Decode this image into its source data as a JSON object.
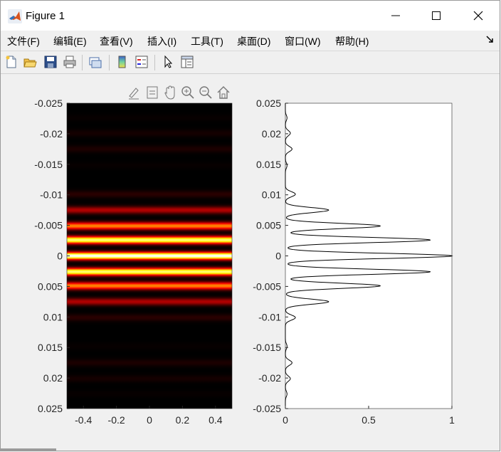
{
  "window": {
    "title": "Figure 1",
    "controls": [
      "minimize",
      "maximize",
      "close"
    ]
  },
  "menu": [
    {
      "label": "文件(F)"
    },
    {
      "label": "编辑(E)"
    },
    {
      "label": "查看(V)"
    },
    {
      "label": "插入(I)"
    },
    {
      "label": "工具(T)"
    },
    {
      "label": "桌面(D)"
    },
    {
      "label": "窗口(W)"
    },
    {
      "label": "帮助(H)"
    }
  ],
  "toolbar": [
    "new-figure-icon",
    "open-file-icon",
    "save-icon",
    "print-icon",
    "link-plot-icon",
    "insert-colorbar-icon",
    "insert-legend-icon",
    "edit-plot-icon",
    "property-inspector-icon"
  ],
  "axes_toolbar": [
    "brush-icon",
    "data-tips-icon",
    "pan-icon",
    "zoom-in-icon",
    "zoom-out-icon",
    "home-icon"
  ],
  "chart_data": [
    {
      "type": "heatmap",
      "colormap": "hot",
      "x_ticks": [
        "-0.4",
        "-0.2",
        "0",
        "0.2",
        "0.4"
      ],
      "xlim": [
        -0.5,
        0.5
      ],
      "y_ticks": [
        "-0.025",
        "-0.02",
        "-0.015",
        "-0.01",
        "-0.005",
        "0",
        "0.005",
        "0.01",
        "0.015",
        "0.02",
        "0.025"
      ],
      "ylim": [
        -0.025,
        0.025
      ],
      "y_direction": "reversed",
      "description_profile": "intensity varies only along y; same profile as right plot"
    },
    {
      "type": "line",
      "x_ticks": [
        "0",
        "0.5",
        "1"
      ],
      "xlim": [
        0,
        1
      ],
      "y_ticks": [
        "0.025",
        "0.02",
        "0.015",
        "0.01",
        "0.005",
        "0",
        "-0.005",
        "-0.01",
        "-0.015",
        "-0.02",
        "-0.025"
      ],
      "ylim": [
        -0.025,
        0.025
      ],
      "color": "#000000",
      "peaks": [
        {
          "y": 0.0,
          "value": 1.0
        },
        {
          "y": 0.0026,
          "value": 0.87
        },
        {
          "y": -0.0026,
          "value": 0.87
        },
        {
          "y": 0.0049,
          "value": 0.57
        },
        {
          "y": -0.0049,
          "value": 0.57
        },
        {
          "y": 0.0075,
          "value": 0.26
        },
        {
          "y": -0.0075,
          "value": 0.26
        },
        {
          "y": 0.0101,
          "value": 0.06
        },
        {
          "y": -0.0101,
          "value": 0.06
        },
        {
          "y": 0.0148,
          "value": 0.01
        },
        {
          "y": -0.0148,
          "value": 0.01
        },
        {
          "y": 0.0175,
          "value": 0.04
        },
        {
          "y": -0.0175,
          "value": 0.04
        },
        {
          "y": 0.0201,
          "value": 0.03
        },
        {
          "y": -0.0201,
          "value": 0.03
        },
        {
          "y": 0.0226,
          "value": 0.01
        },
        {
          "y": -0.0226,
          "value": 0.01
        }
      ]
    }
  ]
}
